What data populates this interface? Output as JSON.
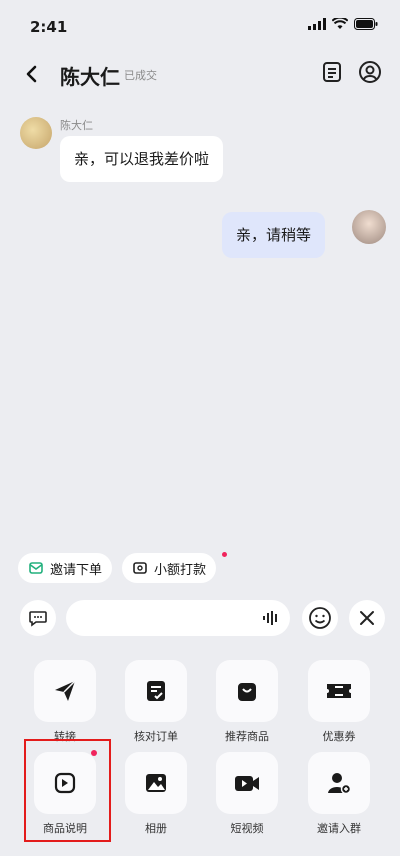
{
  "status": {
    "time": "2:41"
  },
  "nav": {
    "title": "陈大仁",
    "tag": "已成交"
  },
  "messages": [
    {
      "from": "other",
      "name": "陈大仁",
      "text": "亲，可以退我差价啦"
    },
    {
      "from": "me",
      "text": "亲，请稍等"
    }
  ],
  "quick_actions": [
    {
      "label": "邀请下单",
      "icon": "invite-order-icon"
    },
    {
      "label": "小额打款",
      "icon": "transfer-icon",
      "has_badge": true
    }
  ],
  "input": {
    "placeholder": ""
  },
  "tools": [
    {
      "label": "转接",
      "icon": "send-icon"
    },
    {
      "label": "核对订单",
      "icon": "check-order-icon"
    },
    {
      "label": "推荐商品",
      "icon": "shopping-bag-icon"
    },
    {
      "label": "优惠券",
      "icon": "coupon-icon"
    },
    {
      "label": "商品说明",
      "icon": "product-description-icon",
      "has_badge": true,
      "highlighted": true
    },
    {
      "label": "相册",
      "icon": "album-icon"
    },
    {
      "label": "短视频",
      "icon": "video-icon"
    },
    {
      "label": "邀请入群",
      "icon": "invite-group-icon"
    }
  ],
  "colors": {
    "accent_dot": "#f0245c",
    "highlight_border": "#e31b1b",
    "my_bubble": "#dfe6fb"
  }
}
